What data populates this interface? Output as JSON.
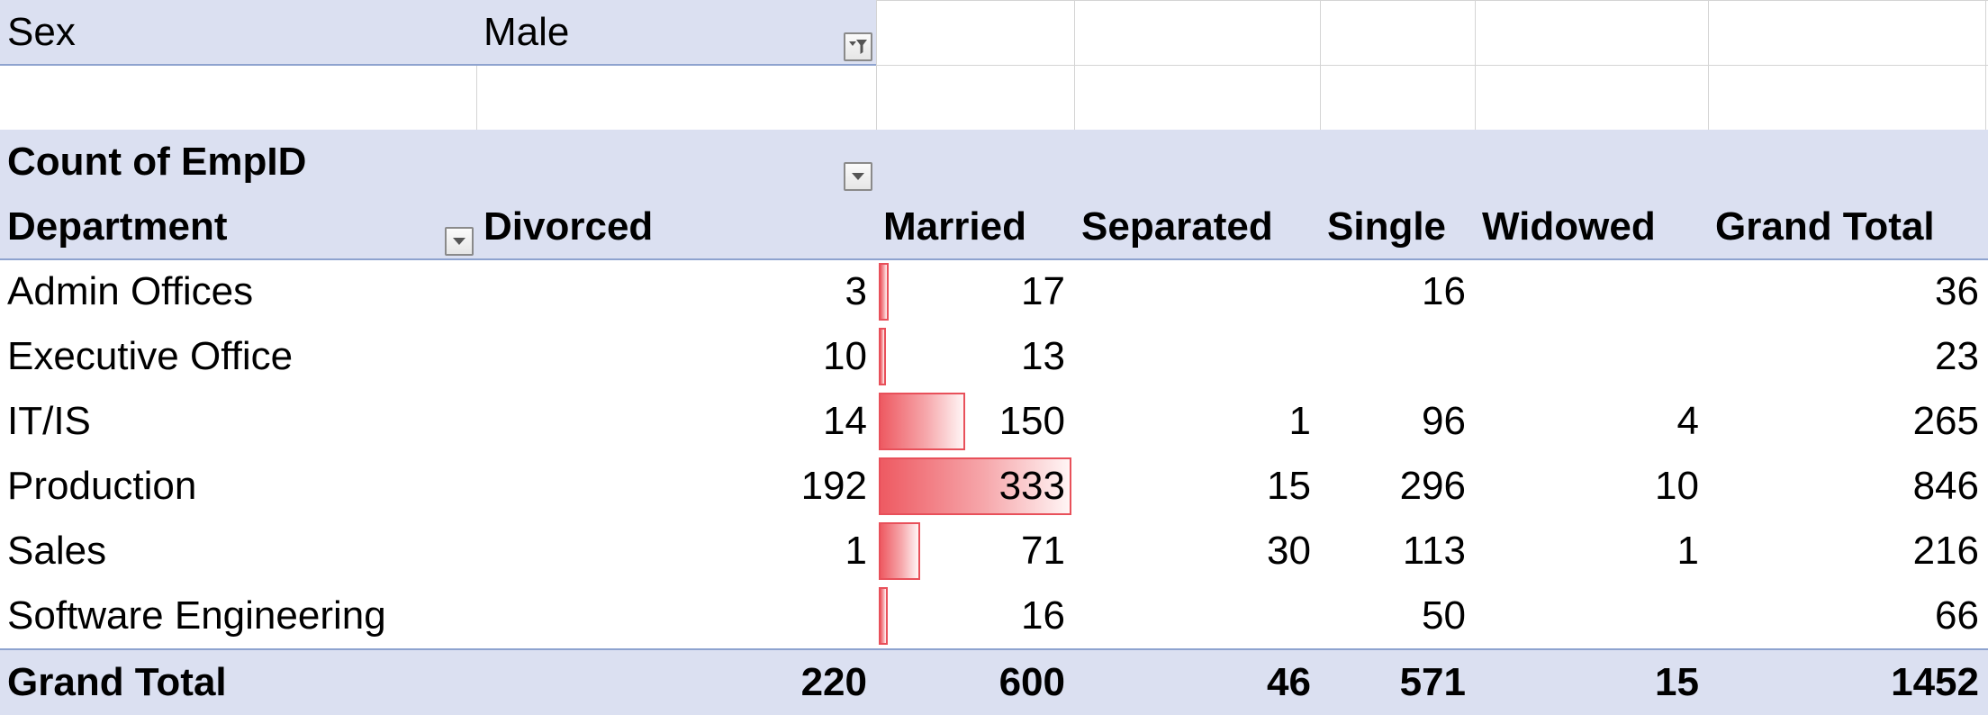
{
  "filter": {
    "field": "Sex",
    "value": "Male"
  },
  "pivot": {
    "value_field": "Count of EmpID",
    "row_field": "Department",
    "columns": [
      "Divorced",
      "Married",
      "Separated",
      "Single",
      "Widowed",
      "Grand Total"
    ],
    "rows": [
      {
        "label": "Admin Offices",
        "values": [
          "3",
          "17",
          "",
          "16",
          "",
          "36"
        ],
        "married": 17
      },
      {
        "label": "Executive Office",
        "values": [
          "10",
          "13",
          "",
          "",
          "",
          "23"
        ],
        "married": 13
      },
      {
        "label": "IT/IS",
        "values": [
          "14",
          "150",
          "1",
          "96",
          "4",
          "265"
        ],
        "married": 150
      },
      {
        "label": "Production",
        "values": [
          "192",
          "333",
          "15",
          "296",
          "10",
          "846"
        ],
        "married": 333
      },
      {
        "label": "Sales",
        "values": [
          "1",
          "71",
          "30",
          "113",
          "1",
          "216"
        ],
        "married": 71
      },
      {
        "label": "Software Engineering",
        "values": [
          "",
          "16",
          "",
          "50",
          "",
          "66"
        ],
        "married": 16
      }
    ],
    "grand_total": {
      "label": "Grand Total",
      "values": [
        "220",
        "600",
        "46",
        "571",
        "15",
        "1452"
      ]
    },
    "databar_max": 333
  },
  "colors": {
    "header_band": "#dbe0f1",
    "band_border": "#8ea3cf",
    "databar": "#ee5a62"
  },
  "icons": {
    "filter_applied": "filter-funnel-icon",
    "dropdown": "chevron-down-icon"
  }
}
